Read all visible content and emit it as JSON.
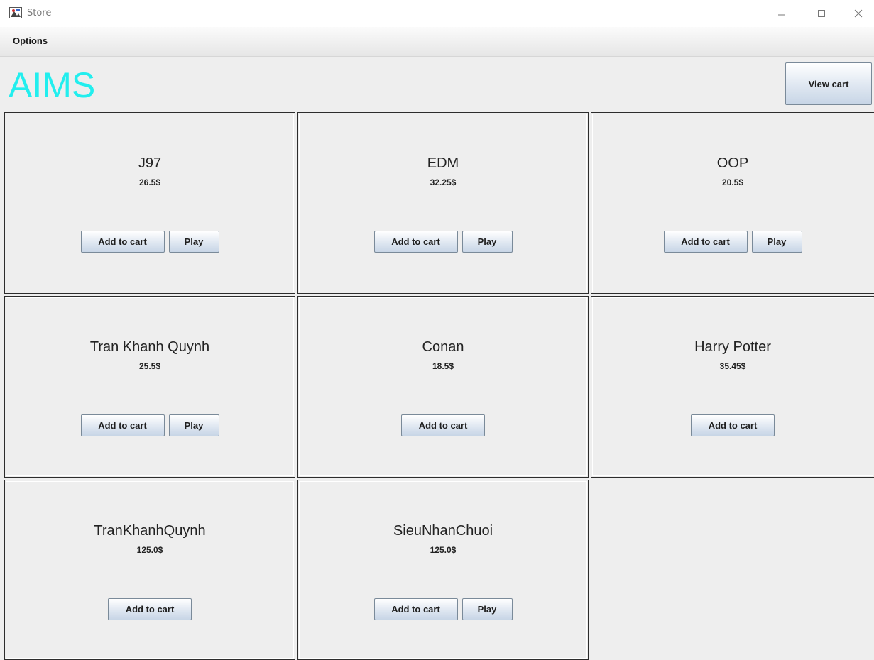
{
  "window": {
    "title": "Store",
    "controls": [
      "minimize-icon",
      "maximize-icon",
      "close-icon"
    ]
  },
  "menu": {
    "options_label": "Options"
  },
  "header": {
    "title": "AIMS",
    "title_color": "#22eeee",
    "view_cart_label": "View cart"
  },
  "items": [
    {
      "title": "J97",
      "price": "26.5$",
      "add_label": "Add to cart",
      "play_label": "Play"
    },
    {
      "title": "EDM",
      "price": "32.25$",
      "add_label": "Add to cart",
      "play_label": "Play"
    },
    {
      "title": "OOP",
      "price": "20.5$",
      "add_label": "Add to cart",
      "play_label": "Play"
    },
    {
      "title": "Tran Khanh Quynh",
      "price": "25.5$",
      "add_label": "Add to cart",
      "play_label": "Play"
    },
    {
      "title": "Conan",
      "price": "18.5$",
      "add_label": "Add to cart"
    },
    {
      "title": "Harry Potter",
      "price": "35.45$",
      "add_label": "Add to cart"
    },
    {
      "title": "TranKhanhQuynh",
      "price": "125.0$",
      "add_label": "Add to cart"
    },
    {
      "title": "SieuNhanChuoi",
      "price": "125.0$",
      "add_label": "Add to cart",
      "play_label": "Play"
    }
  ]
}
